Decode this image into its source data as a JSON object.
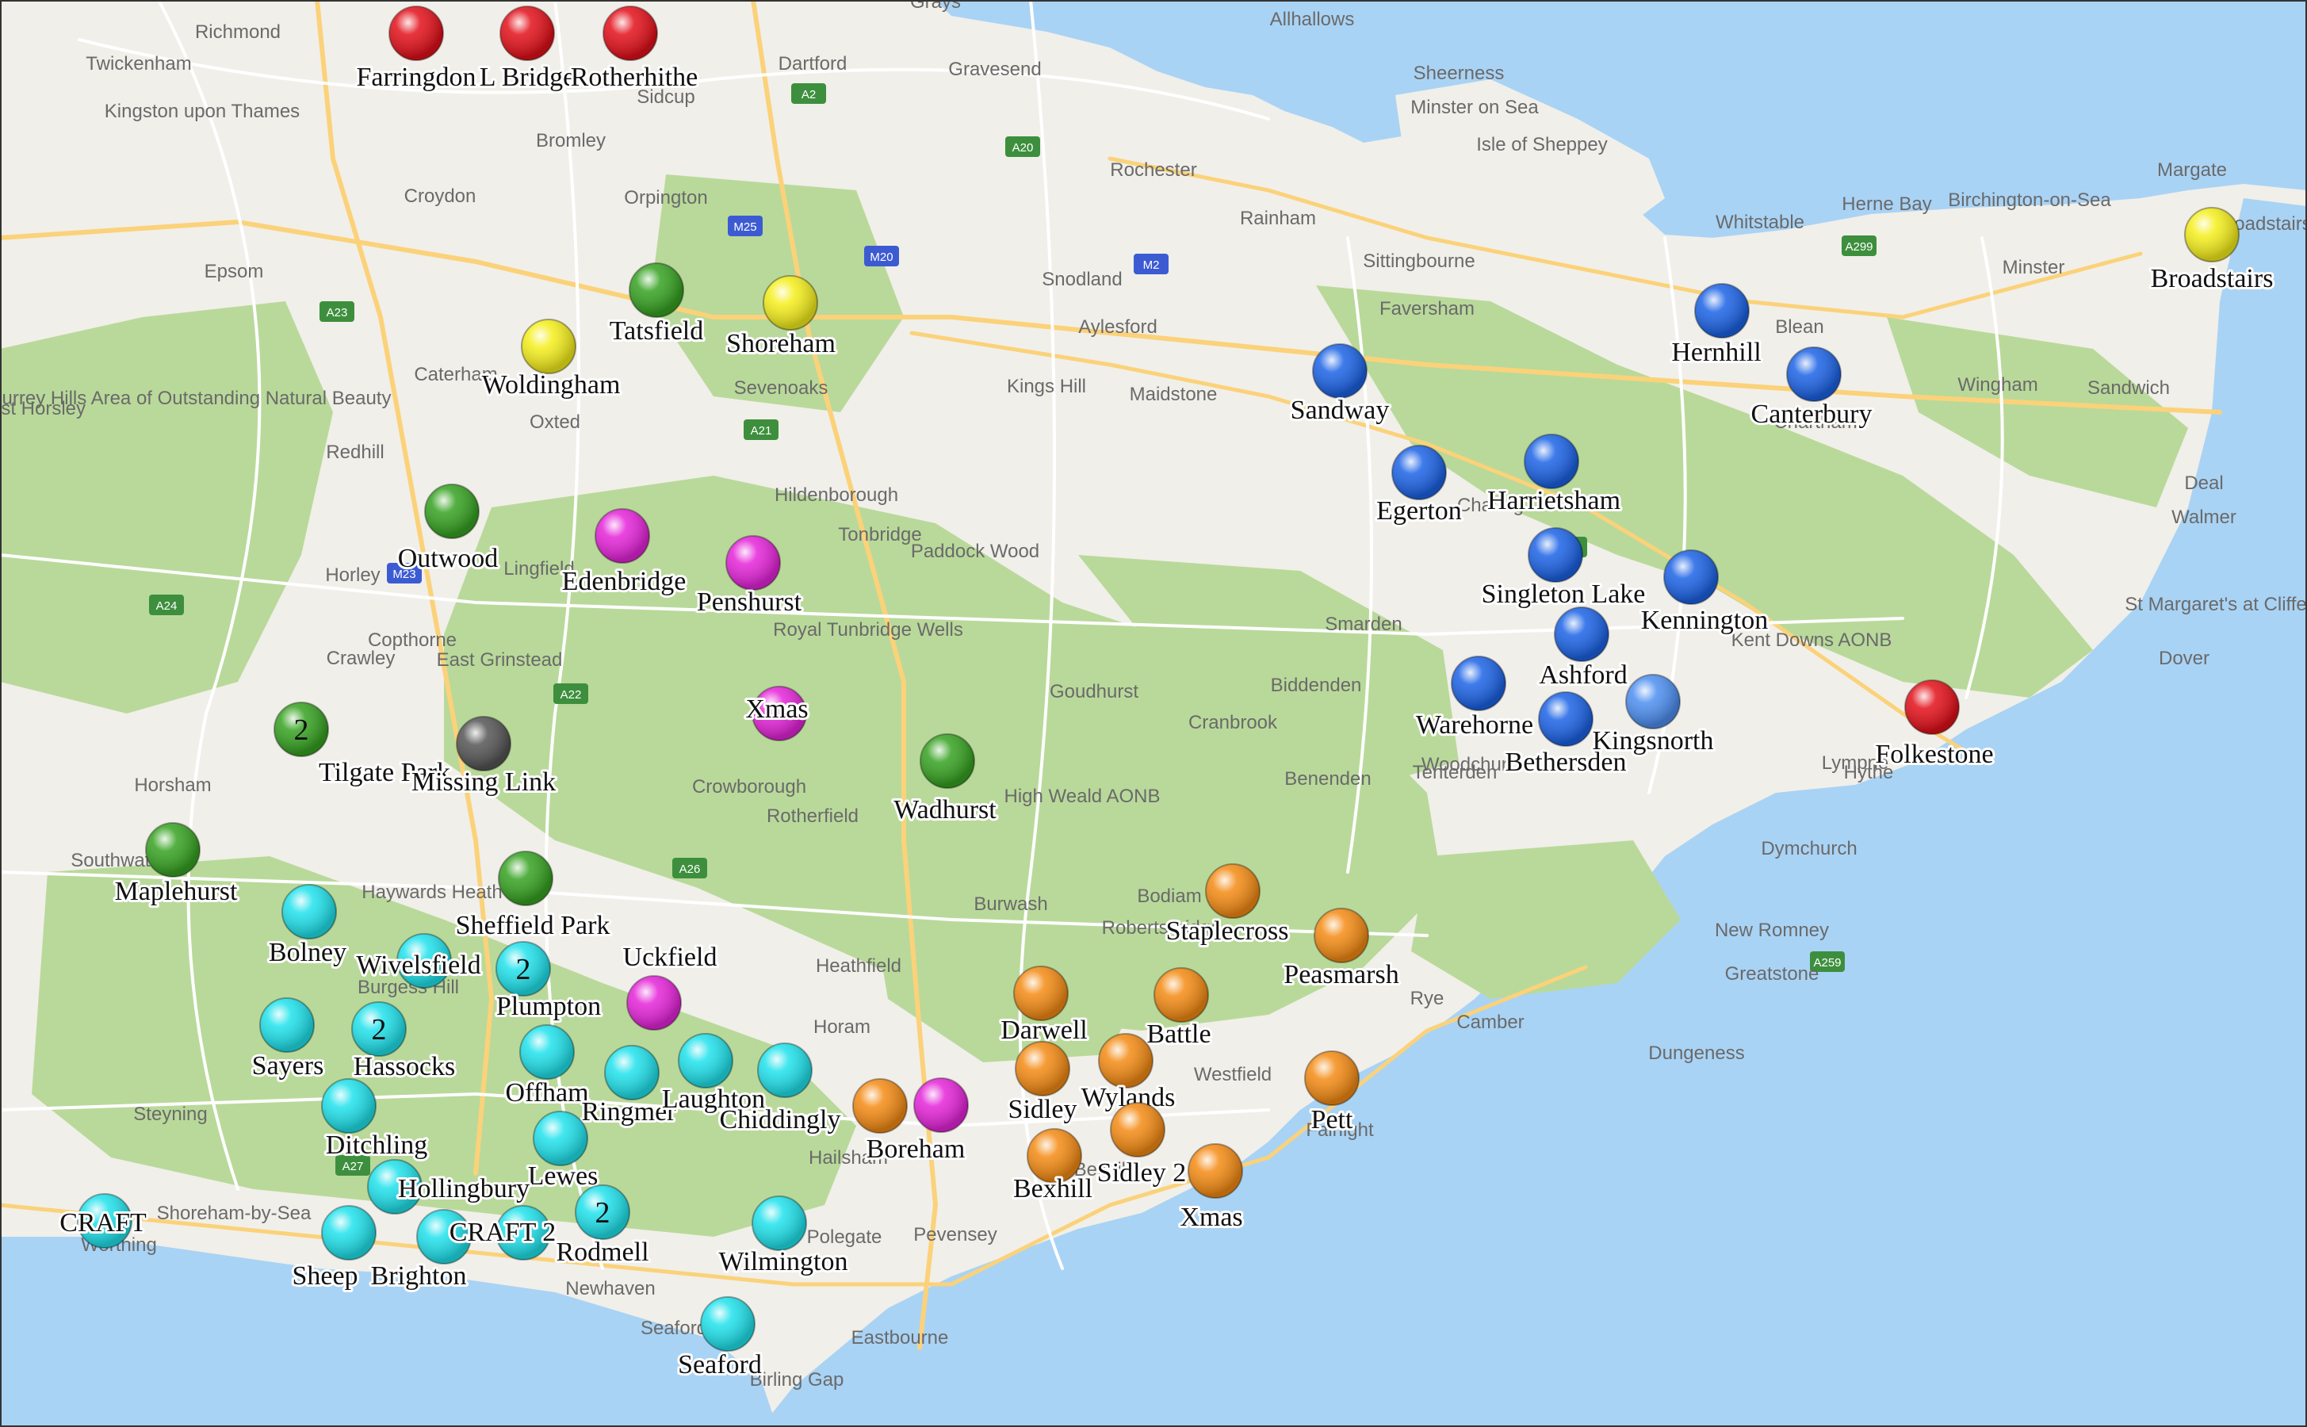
{
  "map": {
    "colors": {
      "water": "#a9d3f5",
      "land": "#f1efe9",
      "park": "#b9d99a",
      "road": "#ffffff",
      "road_major": "#fbd27a",
      "motorway_shield": "#3c5bd3"
    },
    "place_labels": [
      "Richmond",
      "Twickenham",
      "Kingston upon Thames",
      "Epsom",
      "Croydon",
      "Bromley",
      "Dartford",
      "Gravesend",
      "Grays",
      "Allhallows",
      "Sheerness",
      "Minster on Sea",
      "Isle of Sheppey",
      "Rochester",
      "Rainham",
      "Sittingbourne",
      "Faversham",
      "Whitstable",
      "Herne Bay",
      "Birchington-on-Sea",
      "Margate",
      "Minster",
      "Broadstairs",
      "Wingham",
      "Sandwich",
      "Deal",
      "Walmer",
      "St Margaret's at Cliffe",
      "Dover",
      "Hythe",
      "Lympne",
      "Dymchurch",
      "New Romney",
      "Greatstone",
      "Dungeness",
      "Camber",
      "Rye",
      "Tenterden",
      "Woodchurch",
      "Benenden",
      "Cranbrook",
      "Biddenden",
      "Smarden",
      "Charing",
      "Chartham",
      "Maidstone",
      "Aylesford",
      "Snodland",
      "Kings Hill",
      "Sevenoaks",
      "Oxted",
      "Caterham",
      "Redhill",
      "Horley",
      "Crawley",
      "Copthorne",
      "East Grinstead",
      "Lingfield",
      "Tonbridge",
      "Hildenborough",
      "Paddock Wood",
      "Royal Tunbridge Wells",
      "Goudhurst",
      "Crowborough",
      "Rotherfield",
      "High Weald AONB",
      "Burwash",
      "Robertsbridge",
      "Heathfield",
      "Horam",
      "Hailsham",
      "Polegate",
      "Pevensey",
      "Eastbourne",
      "Birling Gap",
      "Seaford",
      "Newhaven",
      "Shoreham-by-Sea",
      "Worthing",
      "Steyning",
      "Burgess Hill",
      "Haywards Heath",
      "Horsham",
      "Southwater",
      "Surrey Hills Area of Outstanding Natural Beauty",
      "East Horsley",
      "Orpington",
      "Sidcup",
      "Westfield",
      "Fairlight",
      "Blean",
      "Kent Downs AONB",
      "Bodiam",
      "Bexhill"
    ],
    "road_shields": [
      "M25",
      "M20",
      "M2",
      "M23",
      "A21",
      "A22",
      "A26",
      "A27",
      "A259",
      "A2",
      "A20",
      "A28",
      "A299",
      "A23",
      "A24"
    ],
    "legend_colors": {
      "red": "#e3101a",
      "yellow": "#f5ef1c",
      "green": "#36a221",
      "magenta": "#e524d9",
      "blue": "#1c63e6",
      "cyan": "#20e2ec",
      "orange": "#f48b14",
      "grey": "#555555",
      "light_blue": "#4d8ff0"
    },
    "markers": [
      {
        "label": "Farringdon",
        "color": "red"
      },
      {
        "label": "L Bridge",
        "color": "red"
      },
      {
        "label": "Rotherhithe",
        "color": "red"
      },
      {
        "label": "Broadstairs",
        "color": "yellow"
      },
      {
        "label": "Folkestone",
        "color": "red"
      },
      {
        "label": "Woldingham",
        "color": "yellow"
      },
      {
        "label": "Shoreham",
        "color": "yellow"
      },
      {
        "label": "Tatsfield",
        "color": "green"
      },
      {
        "label": "Outwood",
        "color": "green"
      },
      {
        "label": "Tilgate Park",
        "color": "green",
        "count": "2"
      },
      {
        "label": "Missing Link",
        "color": "grey"
      },
      {
        "label": "Maplehurst",
        "color": "green"
      },
      {
        "label": "Sheffield Park",
        "color": "green"
      },
      {
        "label": "Wadhurst",
        "color": "green"
      },
      {
        "label": "Edenbridge",
        "color": "magenta"
      },
      {
        "label": "Penshurst",
        "color": "magenta"
      },
      {
        "label": "Xmas",
        "color": "magenta"
      },
      {
        "label": "Uckfield",
        "color": "magenta"
      },
      {
        "label": "Boreham",
        "color": "magenta"
      },
      {
        "label": "Sandway",
        "color": "blue"
      },
      {
        "label": "Hernhill",
        "color": "blue"
      },
      {
        "label": "Canterbury",
        "color": "blue"
      },
      {
        "label": "Egerton",
        "color": "blue"
      },
      {
        "label": "Harrietsham",
        "color": "blue"
      },
      {
        "label": "Singleton Lake",
        "color": "blue"
      },
      {
        "label": "Kennington",
        "color": "blue"
      },
      {
        "label": "Ashford",
        "color": "blue"
      },
      {
        "label": "Warehorne",
        "color": "blue"
      },
      {
        "label": "Bethersden",
        "color": "blue"
      },
      {
        "label": "Kingsnorth",
        "color": "light_blue"
      },
      {
        "label": "Bolney",
        "color": "cyan"
      },
      {
        "label": "Wivelsfield",
        "color": "cyan"
      },
      {
        "label": "Plumpton",
        "color": "cyan",
        "count": "2"
      },
      {
        "label": "Sayers",
        "color": "cyan"
      },
      {
        "label": "Hassocks",
        "color": "cyan",
        "count": "2"
      },
      {
        "label": "Offham",
        "color": "cyan"
      },
      {
        "label": "Ringmer",
        "color": "cyan"
      },
      {
        "label": "Laughton",
        "color": "cyan"
      },
      {
        "label": "Chiddingly",
        "color": "cyan"
      },
      {
        "label": "Ditchling",
        "color": "cyan"
      },
      {
        "label": "Lewes",
        "color": "cyan"
      },
      {
        "label": "Hollingbury",
        "color": "cyan"
      },
      {
        "label": "Rodmell",
        "color": "cyan",
        "count": "2"
      },
      {
        "label": "Wilmington",
        "color": "cyan"
      },
      {
        "label": "CRAFT",
        "color": "cyan"
      },
      {
        "label": "Sheep",
        "color": "cyan"
      },
      {
        "label": "Brighton",
        "color": "cyan"
      },
      {
        "label": "CRAFT 2",
        "color": "cyan"
      },
      {
        "label": "Seaford",
        "color": "cyan"
      },
      {
        "label": "Staplecross",
        "color": "orange"
      },
      {
        "label": "Peasmarsh",
        "color": "orange"
      },
      {
        "label": "Darwell",
        "color": "orange"
      },
      {
        "label": "Battle",
        "color": "orange"
      },
      {
        "label": "Wylands",
        "color": "orange"
      },
      {
        "label": "Sidley",
        "color": "orange"
      },
      {
        "label": "Pett",
        "color": "orange"
      },
      {
        "label": "Bexhill",
        "color": "orange"
      },
      {
        "label": "Sidley 2",
        "color": "orange"
      },
      {
        "label": "Xmas",
        "color": "orange"
      },
      {
        "label": "Boreham",
        "color": "orange"
      }
    ]
  }
}
